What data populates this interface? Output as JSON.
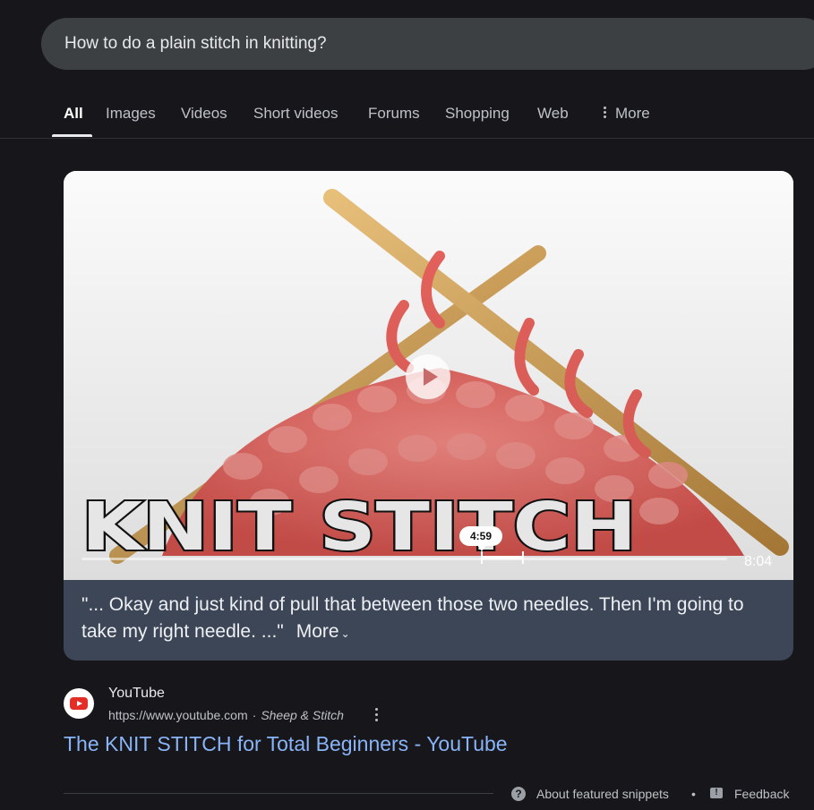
{
  "search": {
    "query": "How to do a plain stitch in knitting?"
  },
  "tabs": [
    {
      "label": "All",
      "active": true
    },
    {
      "label": "Images"
    },
    {
      "label": "Videos"
    },
    {
      "label": "Short videos"
    },
    {
      "label": "Forums"
    },
    {
      "label": "Shopping"
    },
    {
      "label": "Web"
    },
    {
      "label": "More"
    }
  ],
  "video": {
    "overlay_title": "KNIT STITCH",
    "timestamp": "4:59",
    "duration": "8:04",
    "progress_fraction": 0.62,
    "quote": "\"... Okay and just kind of pull that between those two needles. Then I'm going to take my right needle. ...\"",
    "more_label": "More",
    "colors": {
      "yarn": "#e86a64",
      "needle": "#d6a55a",
      "card_bg": "#3c4656"
    }
  },
  "result": {
    "site_name": "YouTube",
    "url": "https://www.youtube.com",
    "separator": "·",
    "author": "Sheep & Stitch",
    "title": "The KNIT STITCH for Total Beginners - YouTube",
    "link_color": "#8ab4f8"
  },
  "footer": {
    "help_icon": "?",
    "about_label": "About featured snippets",
    "bullet": "•",
    "feedback_icon": "!",
    "feedback_label": "Feedback"
  }
}
